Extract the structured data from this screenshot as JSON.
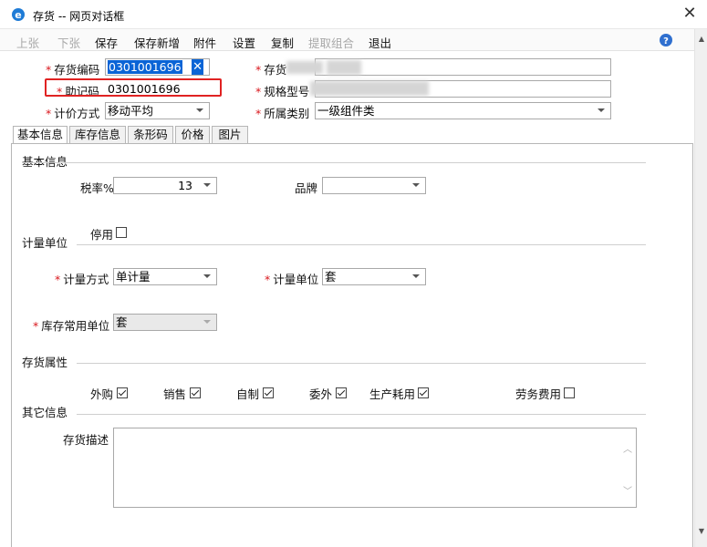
{
  "window": {
    "title": "存货 -- 网页对话框",
    "close_glyph": "✕"
  },
  "toolbar": {
    "buttons": [
      {
        "label": "上张",
        "enabled": false
      },
      {
        "label": "下张",
        "enabled": false
      },
      {
        "label": "保存",
        "enabled": true
      },
      {
        "label": "保存新增",
        "enabled": true
      },
      {
        "label": "附件",
        "enabled": true
      },
      {
        "label": "设置",
        "enabled": true
      },
      {
        "label": "复制",
        "enabled": true
      },
      {
        "label": "提取组合",
        "enabled": false
      },
      {
        "label": "退出",
        "enabled": true
      }
    ],
    "help_icon": "help-icon"
  },
  "header": {
    "req_mark": "*",
    "inventory_code": {
      "label": "存货编码",
      "value": "0301001696",
      "clear_glyph": "✕"
    },
    "inventory": {
      "label": "存货",
      "value": ""
    },
    "mnemonic": {
      "label": "助记码",
      "value": "0301001696"
    },
    "spec": {
      "label": "规格型号",
      "value": ""
    },
    "valuation": {
      "label": "计价方式",
      "value": "移动平均"
    },
    "category": {
      "label": "所属类别",
      "value": "一级组件类"
    }
  },
  "tabs": [
    "基本信息",
    "库存信息",
    "条形码",
    "价格",
    "图片"
  ],
  "basic": {
    "section_title": "基本信息",
    "tax_rate": {
      "label": "税率%",
      "value": "13"
    },
    "brand": {
      "label": "品牌",
      "value": ""
    }
  },
  "unit": {
    "section_title": "计量单位",
    "disabled_label": "停用",
    "disabled_checked": false,
    "mode": {
      "label": "计量方式",
      "value": "单计量"
    },
    "unit": {
      "label": "计量单位",
      "value": "套"
    },
    "stock_unit": {
      "label": "库存常用单位",
      "value": "套"
    }
  },
  "attributes": {
    "section_title": "存货属性",
    "items": [
      {
        "label": "外购",
        "checked": true
      },
      {
        "label": "销售",
        "checked": true
      },
      {
        "label": "自制",
        "checked": true
      },
      {
        "label": "委外",
        "checked": true
      },
      {
        "label": "生产耗用",
        "checked": true
      },
      {
        "label": "劳务费用",
        "checked": false
      }
    ]
  },
  "other": {
    "section_title": "其它信息",
    "desc_label": "存货描述",
    "desc_value": "",
    "scroll_up": "︿",
    "scroll_down": "﹀"
  },
  "colors": {
    "required": "#d9161c",
    "highlight": "#e02222",
    "selection": "#0a64d6",
    "disabled_text": "#a8a8a8"
  }
}
